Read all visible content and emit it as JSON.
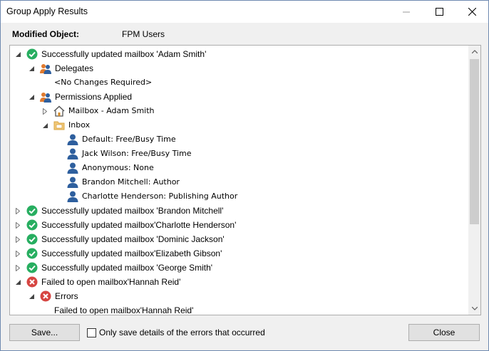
{
  "window": {
    "title": "Group Apply Results",
    "minimize_icon": "minimize-icon",
    "maximize_icon": "maximize-icon",
    "close_icon": "close-icon"
  },
  "header": {
    "label": "Modified Object:",
    "value": "FPM Users"
  },
  "tree": {
    "rows": [
      {
        "text": "Successfully updated mailbox 'Adam Smith'",
        "icon": "success-check-icon",
        "expander": "expanded",
        "level": 0
      },
      {
        "text": "Delegates",
        "icon": "users-icon",
        "expander": "expanded",
        "level": 1
      },
      {
        "text": "<No Changes Required>",
        "icon": "",
        "expander": "none",
        "level": 2,
        "mono": true
      },
      {
        "text": "Permissions Applied",
        "icon": "users-icon",
        "expander": "expanded",
        "level": 1
      },
      {
        "text": "Mailbox - Adam Smith",
        "icon": "home-icon",
        "expander": "collapsed",
        "level": 2,
        "mono": true
      },
      {
        "text": "Inbox",
        "icon": "inbox-folder-icon",
        "expander": "expanded",
        "level": 2,
        "mono": true
      },
      {
        "text": "Default: Free/Busy Time",
        "icon": "user-icon",
        "expander": "none",
        "level": 3,
        "mono": true
      },
      {
        "text": "Jack Wilson: Free/Busy Time",
        "icon": "user-icon",
        "expander": "none",
        "level": 3,
        "mono": true
      },
      {
        "text": "Anonymous: None",
        "icon": "user-icon",
        "expander": "none",
        "level": 3,
        "mono": true
      },
      {
        "text": "Brandon Mitchell: Author",
        "icon": "user-icon",
        "expander": "none",
        "level": 3,
        "mono": true
      },
      {
        "text": "Charlotte Henderson: Publishing Author",
        "icon": "user-icon",
        "expander": "none",
        "level": 3,
        "mono": true
      },
      {
        "text": "Successfully updated mailbox 'Brandon Mitchell'",
        "icon": "success-check-icon",
        "expander": "collapsed",
        "level": 0
      },
      {
        "text": "Successfully updated mailbox'Charlotte Henderson'",
        "icon": "success-check-icon",
        "expander": "collapsed",
        "level": 0
      },
      {
        "text": "Successfully updated mailbox 'Dominic Jackson'",
        "icon": "success-check-icon",
        "expander": "collapsed",
        "level": 0
      },
      {
        "text": "Successfully updated mailbox'Elizabeth Gibson'",
        "icon": "success-check-icon",
        "expander": "collapsed",
        "level": 0
      },
      {
        "text": "Successfully updated mailbox 'George Smith'",
        "icon": "success-check-icon",
        "expander": "collapsed",
        "level": 0
      },
      {
        "text": "Failed to open mailbox'Hannah Reid'",
        "icon": "error-x-icon",
        "expander": "expanded",
        "level": 0
      },
      {
        "text": "Errors",
        "icon": "error-x-icon",
        "expander": "expanded",
        "level": 1
      },
      {
        "text": "Failed to open mailbox'Hannah Reid'",
        "icon": "",
        "expander": "none",
        "level": 2
      }
    ]
  },
  "footer": {
    "save_label": "Save...",
    "checkbox_label": "Only save details of the errors that occurred",
    "checkbox_checked": false,
    "close_label": "Close"
  },
  "colors": {
    "success": "#27ae60",
    "error": "#d64541",
    "user": "#2e5f9e",
    "accent_users": "#e07a2e"
  }
}
